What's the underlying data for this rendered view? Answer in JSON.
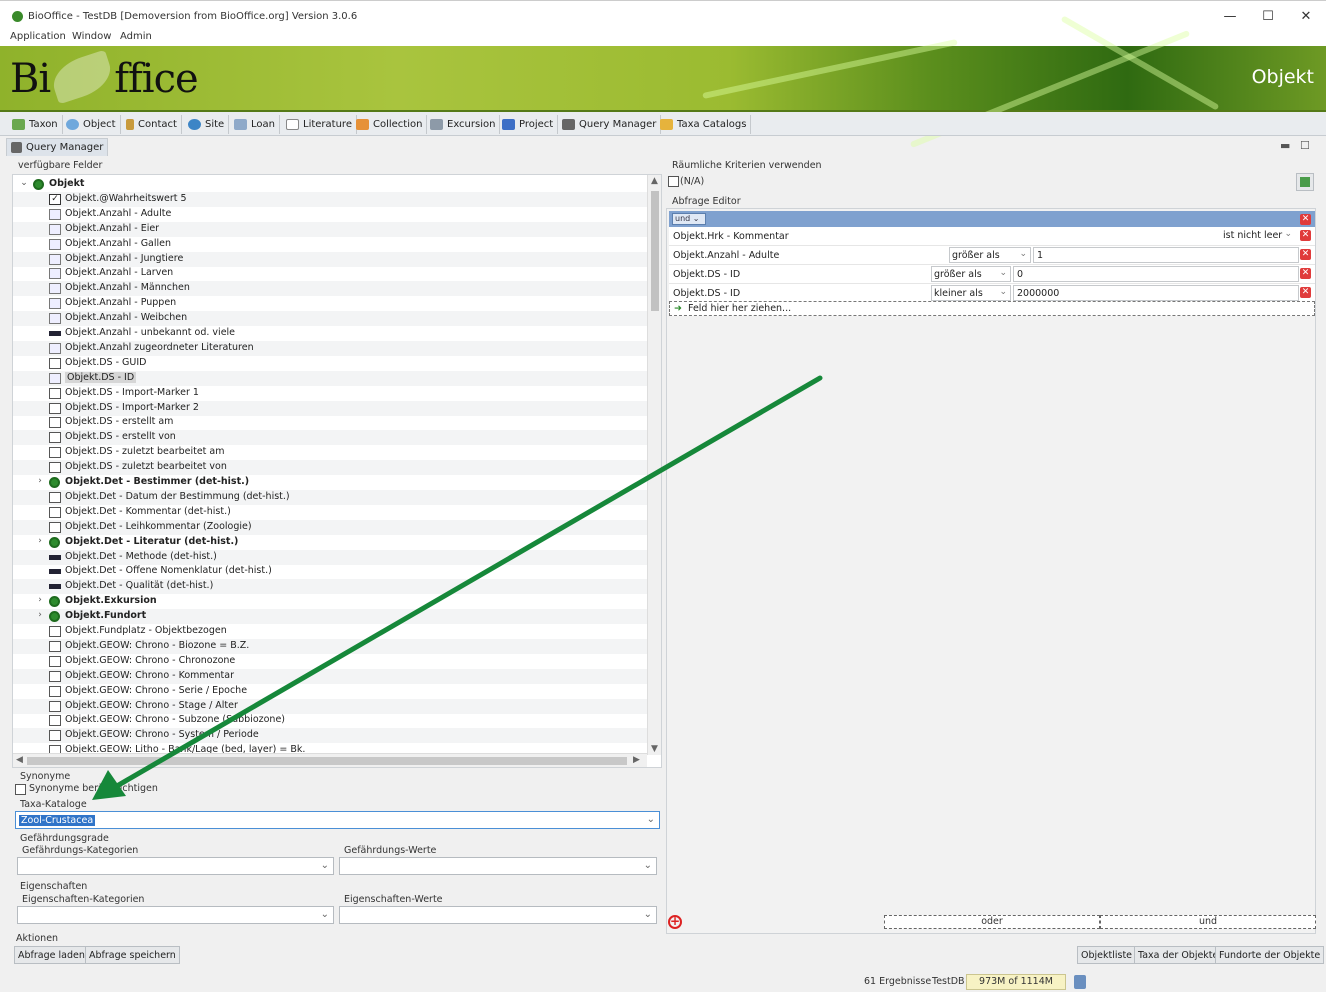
{
  "window": {
    "title": "BioOffice - TestDB [Demoversion from BioOffice.org] Version 3.0.6",
    "controls": [
      "—",
      "☐",
      "✕"
    ]
  },
  "menu": [
    "Application",
    "Window",
    "Admin"
  ],
  "banner": {
    "logo": "BioOffice",
    "logo_left": "Bi",
    "logo_right": "ffice",
    "section": "Objekt"
  },
  "toolbar": [
    {
      "label": "Taxon",
      "icon": "taxon-icon",
      "color": "#6aa84f"
    },
    {
      "label": "Object",
      "icon": "object-icon",
      "color": "#6fa8dc"
    },
    {
      "label": "Contact",
      "icon": "contact-icon",
      "color": "#c89a3c"
    },
    {
      "label": "Site",
      "icon": "site-icon",
      "color": "#3d85c6"
    },
    {
      "label": "Loan",
      "icon": "loan-icon",
      "color": "#8ea9c9"
    },
    {
      "label": "Literature",
      "icon": "literature-icon",
      "color": "#b7b7b7"
    },
    {
      "label": "Collection",
      "icon": "collection-icon",
      "color": "#e69138"
    },
    {
      "label": "Excursion",
      "icon": "excursion-icon",
      "color": "#8d9aa8"
    },
    {
      "label": "Project",
      "icon": "project-icon",
      "color": "#3d6fc6"
    },
    {
      "label": "Query Manager",
      "icon": "query-manager-icon",
      "color": "#666666"
    },
    {
      "label": "Taxa Catalogs",
      "icon": "taxa-catalogs-icon",
      "color": "#e6b33c"
    }
  ],
  "tab": {
    "label": "Query Manager"
  },
  "left": {
    "available_fields_label": "verfügbare Felder",
    "tree": [
      {
        "t": "Objekt",
        "kind": "group",
        "level": 0,
        "expanded": true
      },
      {
        "t": "Objekt.@Wahrheitswert 5",
        "kind": "chk",
        "level": 1
      },
      {
        "t": "Objekt.Anzahl - Adulte",
        "kind": "num",
        "level": 1
      },
      {
        "t": "Objekt.Anzahl - Eier",
        "kind": "num",
        "level": 1
      },
      {
        "t": "Objekt.Anzahl - Gallen",
        "kind": "num",
        "level": 1
      },
      {
        "t": "Objekt.Anzahl - Jungtiere",
        "kind": "num",
        "level": 1
      },
      {
        "t": "Objekt.Anzahl - Larven",
        "kind": "num",
        "level": 1
      },
      {
        "t": "Objekt.Anzahl - Männchen",
        "kind": "num",
        "level": 1
      },
      {
        "t": "Objekt.Anzahl - Puppen",
        "kind": "num",
        "level": 1
      },
      {
        "t": "Objekt.Anzahl - Weibchen",
        "kind": "num",
        "level": 1
      },
      {
        "t": "Objekt.Anzahl - unbekannt od. viele",
        "kind": "bar",
        "level": 1
      },
      {
        "t": "Objekt.Anzahl zugeordneter Literaturen",
        "kind": "num",
        "level": 1
      },
      {
        "t": "Objekt.DS - GUID",
        "kind": "txt",
        "level": 1
      },
      {
        "t": "Objekt.DS - ID",
        "kind": "num",
        "level": 1,
        "selected": true
      },
      {
        "t": "Objekt.DS - Import-Marker 1",
        "kind": "txt",
        "level": 1
      },
      {
        "t": "Objekt.DS - Import-Marker 2",
        "kind": "txt",
        "level": 1
      },
      {
        "t": "Objekt.DS - erstellt am",
        "kind": "date",
        "level": 1
      },
      {
        "t": "Objekt.DS - erstellt von",
        "kind": "txt",
        "level": 1
      },
      {
        "t": "Objekt.DS - zuletzt bearbeitet am",
        "kind": "date",
        "level": 1
      },
      {
        "t": "Objekt.DS - zuletzt bearbeitet von",
        "kind": "txt",
        "level": 1
      },
      {
        "t": "Objekt.Det - Bestimmer (det-hist.)",
        "kind": "group",
        "level": 1
      },
      {
        "t": "Objekt.Det - Datum der Bestimmung (det-hist.)",
        "kind": "date",
        "level": 1
      },
      {
        "t": "Objekt.Det - Kommentar (det-hist.)",
        "kind": "txt",
        "level": 1
      },
      {
        "t": "Objekt.Det - Leihkommentar (Zoologie)",
        "kind": "date",
        "level": 1
      },
      {
        "t": "Objekt.Det - Literatur (det-hist.)",
        "kind": "group",
        "level": 1
      },
      {
        "t": "Objekt.Det - Methode (det-hist.)",
        "kind": "bar",
        "level": 1
      },
      {
        "t": "Objekt.Det - Offene Nomenklatur (det-hist.)",
        "kind": "bar",
        "level": 1
      },
      {
        "t": "Objekt.Det - Qualität (det-hist.)",
        "kind": "bar",
        "level": 1
      },
      {
        "t": "Objekt.Exkursion",
        "kind": "group",
        "level": 1
      },
      {
        "t": "Objekt.Fundort",
        "kind": "group",
        "level": 1
      },
      {
        "t": "Objekt.Fundplatz - Objektbezogen",
        "kind": "date",
        "level": 1
      },
      {
        "t": "Objekt.GEOW: Chrono - Biozone = B.Z.",
        "kind": "txt",
        "level": 1
      },
      {
        "t": "Objekt.GEOW: Chrono - Chronozone",
        "kind": "txt",
        "level": 1
      },
      {
        "t": "Objekt.GEOW: Chrono - Kommentar",
        "kind": "txt",
        "level": 1
      },
      {
        "t": "Objekt.GEOW: Chrono - Serie / Epoche",
        "kind": "txt",
        "level": 1
      },
      {
        "t": "Objekt.GEOW: Chrono - Stage / Alter",
        "kind": "txt",
        "level": 1
      },
      {
        "t": "Objekt.GEOW: Chrono - Subzone (Subbiozone)",
        "kind": "txt",
        "level": 1
      },
      {
        "t": "Objekt.GEOW: Chrono - System / Periode",
        "kind": "txt",
        "level": 1
      },
      {
        "t": "Objekt.GEOW: Litho - Bank/Lage (bed, layer) = Bk.",
        "kind": "txt",
        "level": 1
      }
    ],
    "synonyme_section": "Synonyme",
    "synonyme_checkbox": "Synonyme berücksichtigen",
    "taxa_catalog_label": "Taxa-Kataloge",
    "taxa_catalog_value": "Zool-Crustacea",
    "threat_section": "Gefährdungsgrade",
    "threat_categories_label": "Gefährdungs-Kategorien",
    "threat_values_label": "Gefährdungs-Werte",
    "props_section": "Eigenschaften",
    "props_categories_label": "Eigenschaften-Kategorien",
    "props_values_label": "Eigenschaften-Werte",
    "actions_section": "Aktionen",
    "load_query": "Abfrage laden",
    "save_query": "Abfrage speichern"
  },
  "right": {
    "spatial_label": "Räumliche Kriterien verwenden",
    "spatial_checkbox": "(N/A)",
    "editor_label": "Abfrage Editor",
    "conjunction": "und",
    "rows": [
      {
        "field": "Objekt.Hrk - Kommentar",
        "op": "ist nicht leer",
        "value": ""
      },
      {
        "field": "Objekt.Anzahl - Adulte",
        "op": "größer als",
        "value": "1"
      },
      {
        "field": "Objekt.DS - ID",
        "op": "größer als",
        "value": "0"
      },
      {
        "field": "Objekt.DS - ID",
        "op": "kleiner als",
        "value": "2000000"
      }
    ],
    "drop_hint": "Feld hier her ziehen...",
    "or_button": "oder",
    "and_button": "und",
    "buttons": [
      "Objektliste",
      "Taxa der Objekte",
      "Fundorte der Objekte"
    ]
  },
  "status": {
    "results": "61 Ergebnisse",
    "db": "TestDB",
    "memory": "973M of 1114M"
  },
  "colors": {
    "accent": "#1a8a3a",
    "selection": "#3074c8"
  }
}
